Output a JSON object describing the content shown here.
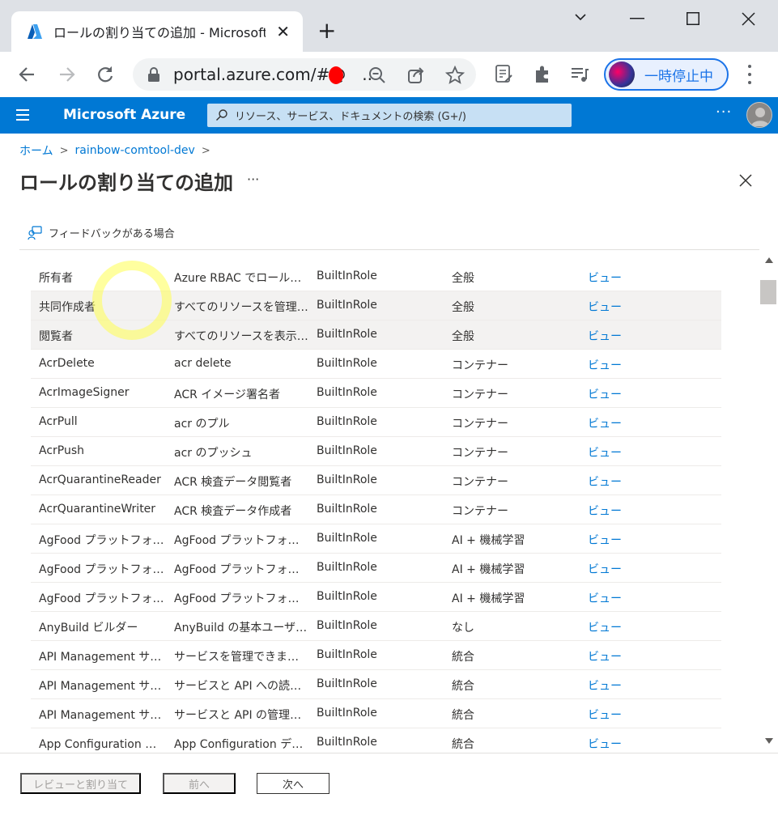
{
  "browser": {
    "tab_title": "ロールの割り当ての追加 - Microsoft",
    "url": "portal.azure.com/#@",
    "url_suffix": "..",
    "profile_label": "一時停止中"
  },
  "azure": {
    "brand": "Microsoft Azure",
    "search_placeholder": "リソース、サービス、ドキュメントの検索 (G+/)",
    "more": "···"
  },
  "breadcrumb": {
    "home": "ホーム",
    "resource": "rainbow-comtool-dev",
    "sep": ">"
  },
  "page": {
    "title": "ロールの割り当ての追加",
    "more": "···",
    "feedback": "フィードバックがある場合"
  },
  "grid": {
    "rows": [
      {
        "name": "所有者",
        "desc": "Azure RBAC でロールを割...",
        "type": "BuiltInRole",
        "category": "全般",
        "details": "ビュー"
      },
      {
        "name": "共同作成者",
        "desc": "すべてのリソースを管理する...",
        "type": "BuiltInRole",
        "category": "全般",
        "details": "ビュー"
      },
      {
        "name": "閲覧者",
        "desc": "すべてのリソースを表示しま...",
        "type": "BuiltInRole",
        "category": "全般",
        "details": "ビュー"
      },
      {
        "name": "AcrDelete",
        "desc": "acr delete",
        "type": "BuiltInRole",
        "category": "コンテナー",
        "details": "ビュー"
      },
      {
        "name": "AcrImageSigner",
        "desc": "ACR イメージ署名者",
        "type": "BuiltInRole",
        "category": "コンテナー",
        "details": "ビュー"
      },
      {
        "name": "AcrPull",
        "desc": "acr のプル",
        "type": "BuiltInRole",
        "category": "コンテナー",
        "details": "ビュー"
      },
      {
        "name": "AcrPush",
        "desc": "acr のプッシュ",
        "type": "BuiltInRole",
        "category": "コンテナー",
        "details": "ビュー"
      },
      {
        "name": "AcrQuarantineReader",
        "desc": "ACR 検査データ閲覧者",
        "type": "BuiltInRole",
        "category": "コンテナー",
        "details": "ビュー"
      },
      {
        "name": "AcrQuarantineWriter",
        "desc": "ACR 検査データ作成者",
        "type": "BuiltInRole",
        "category": "コンテナー",
        "details": "ビュー"
      },
      {
        "name": "AgFood プラットフォーム ...",
        "desc": "AgFood プラットフォーム サ...",
        "type": "BuiltInRole",
        "category": "AI + 機械学習",
        "details": "ビュー"
      },
      {
        "name": "AgFood プラットフォーム ...",
        "desc": "AgFood プラットフォーム サ...",
        "type": "BuiltInRole",
        "category": "AI + 機械学習",
        "details": "ビュー"
      },
      {
        "name": "AgFood プラットフォーム ...",
        "desc": "AgFood プラットフォーム サ...",
        "type": "BuiltInRole",
        "category": "AI + 機械学習",
        "details": "ビュー"
      },
      {
        "name": "AnyBuild ビルダー",
        "desc": "AnyBuild の基本ユーザー ...",
        "type": "BuiltInRole",
        "category": "なし",
        "details": "ビュー"
      },
      {
        "name": "API Management サー...",
        "desc": "サービスを管理できますが、...",
        "type": "BuiltInRole",
        "category": "統合",
        "details": "ビュー"
      },
      {
        "name": "API Management サー...",
        "desc": "サービスと API への読み取...",
        "type": "BuiltInRole",
        "category": "統合",
        "details": "ビュー"
      },
      {
        "name": "API Management サー...",
        "desc": "サービスと API の管理が可能",
        "type": "BuiltInRole",
        "category": "統合",
        "details": "ビュー"
      },
      {
        "name": "App Configuration デー...",
        "desc": "App Configuration データ...",
        "type": "BuiltInRole",
        "category": "統合",
        "details": "ビュー"
      }
    ]
  },
  "footer": {
    "review_assign": "レビューと割り当て",
    "previous": "前へ",
    "next": "次へ"
  },
  "colors": {
    "azure_blue": "#0078d4",
    "link": "#0078d4",
    "row_highlight": "#f3f2f1"
  }
}
